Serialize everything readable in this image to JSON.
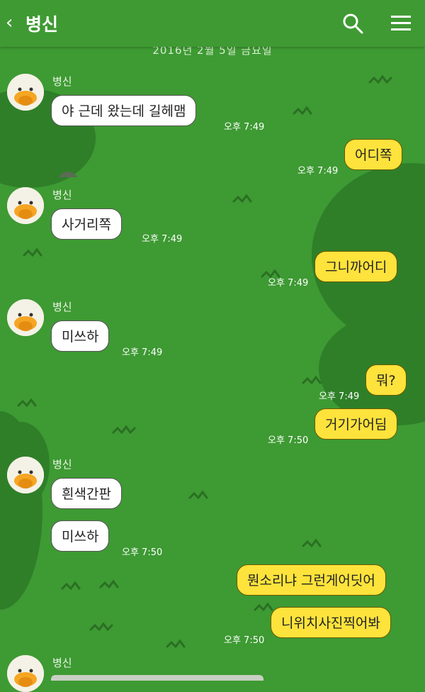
{
  "header": {
    "title": "병신",
    "colors": {
      "bar": "#3f9a33",
      "text": "#ffffff"
    }
  },
  "date_label": "2016년 2월 5일 금요일",
  "messages": [
    {
      "dir": "in",
      "sender": "병신",
      "text": "야 근데 왔는데 길헤맴",
      "time": "오후 7:49"
    },
    {
      "dir": "out",
      "text": "어디쪽",
      "time": "오후 7:49"
    },
    {
      "dir": "in",
      "sender": "병신",
      "text": "사거리쪽",
      "time": "오후 7:49"
    },
    {
      "dir": "out",
      "text": "그니까어디",
      "time": "오후 7:49"
    },
    {
      "dir": "in",
      "sender": "병신",
      "text": "미쓰하",
      "time": "오후 7:49"
    },
    {
      "dir": "out",
      "text": "뭐?",
      "time": "오후 7:49"
    },
    {
      "dir": "out",
      "text": "거기가어딤",
      "time": "오후 7:50"
    },
    {
      "dir": "in",
      "sender": "병신",
      "text": "흰색간판"
    },
    {
      "dir": "in",
      "text": "미쓰하",
      "time": "오후 7:50"
    },
    {
      "dir": "out",
      "text": "뭔소리냐 그런게어딧어"
    },
    {
      "dir": "out",
      "text": "니위치사진찍어봐",
      "time": "오후 7:50"
    },
    {
      "dir": "in",
      "sender": "병신"
    }
  ],
  "colors": {
    "background": "#3e9a33",
    "bubble_in": "#ffffff",
    "bubble_out": "#fde33b"
  }
}
